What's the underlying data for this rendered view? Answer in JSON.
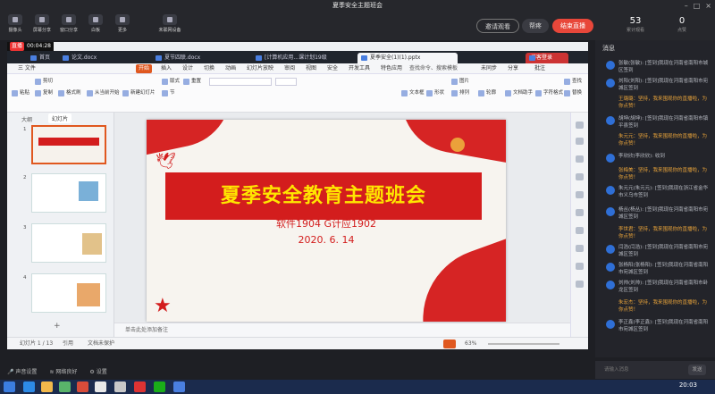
{
  "window": {
    "title": "夏季安全主题班会"
  },
  "toolbar": [
    {
      "label": "摄像头",
      "icon": "camera-icon"
    },
    {
      "label": "屏幕分享",
      "icon": "screen-share-icon"
    },
    {
      "label": "窗口分享",
      "icon": "window-share-icon"
    },
    {
      "label": "白板",
      "icon": "whiteboard-icon"
    },
    {
      "label": "更多",
      "icon": "more-icon"
    },
    {
      "label": "未联网设备",
      "icon": "device-icon"
    }
  ],
  "actions": {
    "invite": "邀请观看",
    "help": "帮疼",
    "end": "结束直播"
  },
  "stats": {
    "viewers": "53",
    "viewers_label": "累计观看",
    "likes": "0",
    "likes_label": "点赞"
  },
  "live": {
    "tag": "直播",
    "time": "00:04:28"
  },
  "browser_tabs": [
    "首页",
    "论文.docx",
    "夏节四联.docx",
    "[计算机应用...课计划19级",
    "夏季安全(1)(1).pptx",
    "访客登录"
  ],
  "menu": [
    "三 文件",
    "开始",
    "插入",
    "设计",
    "切换",
    "动画",
    "幻灯片放映",
    "审阅",
    "视图",
    "安全",
    "开发工具",
    "特色应用",
    "查找命令、搜索模板",
    "未同步",
    "分享",
    "批注"
  ],
  "ribbon": [
    "粘贴",
    "剪切",
    "复制",
    "格式刷",
    "从当前开始",
    "新建幻灯片",
    "版式",
    "节",
    "重置",
    "文本框",
    "形状",
    "图片",
    "排列",
    "轮廓",
    "文档助手",
    "字符格式",
    "查找",
    "替换"
  ],
  "left_tabs": [
    "大纲",
    "幻灯片"
  ],
  "slide": {
    "title": "夏季安全教育主题班会",
    "subtitle": "软件1904   G计应1902",
    "date": "2020. 6. 14"
  },
  "thumbs": [
    "1",
    "2",
    "3",
    "4"
  ],
  "notes_placeholder": "单击此处添加备注",
  "statusbar": {
    "slide_info": "幻灯片 1 / 13",
    "theme": "引用",
    "protect": "文档未保护",
    "zoom": "63%"
  },
  "chat": {
    "header": "消息",
    "messages": [
      {
        "type": "usr",
        "text": "张敏(张敏): [签到]我现在河南省南阳市城区签到"
      },
      {
        "type": "usr",
        "text": "刘阳(刘阳): [签到]我现在河南省南阳市宛城区签到"
      },
      {
        "type": "sys",
        "text": "王璐璐：坚持，我来围观你的直播啦，为你点赞！"
      },
      {
        "type": "usr",
        "text": "胡坤(胡坤): [签到]我现在河南省南阳市镇平县签到"
      },
      {
        "type": "sys",
        "text": "朱元元：坚持，我来围观你的直播啦，为你点赞！"
      },
      {
        "type": "usr",
        "text": "李欣欣(李欣欣): 收到"
      },
      {
        "type": "sys",
        "text": "张梅美：坚持，我来围观你的直播啦，为你点赞！"
      },
      {
        "type": "usr",
        "text": "朱元元(朱元元): [签到]我现在浙江省金华市义乌市签到"
      },
      {
        "type": "usr",
        "text": "杨丛(杨丛): [签到]我现在河南省南阳市宛城区签到"
      },
      {
        "type": "sys",
        "text": "李世君：坚持，我来围观你的直播啦，为你点赞！"
      },
      {
        "type": "usr",
        "text": "闫浩(闫浩): [签到]我现在河南省南阳市宛城区签到"
      },
      {
        "type": "usr",
        "text": "张杨阳(张杨阳): [签到]我现在河南省南阳市宛城区签到"
      },
      {
        "type": "usr",
        "text": "刘帅(刘帅): [签到]我现在河南省南阳市卧龙区签到"
      },
      {
        "type": "sys",
        "text": "朱宏杰：坚持，我来围观你的直播啦，为你点赞！"
      },
      {
        "type": "usr",
        "text": "李正鑫(李正鑫): [签到]我现在河南省南阳市宛城区签到"
      }
    ],
    "input_placeholder": "请输入消息",
    "send": "发送"
  },
  "bottom": {
    "audio": "声音设置",
    "network": "网络良好",
    "settings": "设置"
  },
  "clock": "20:03"
}
